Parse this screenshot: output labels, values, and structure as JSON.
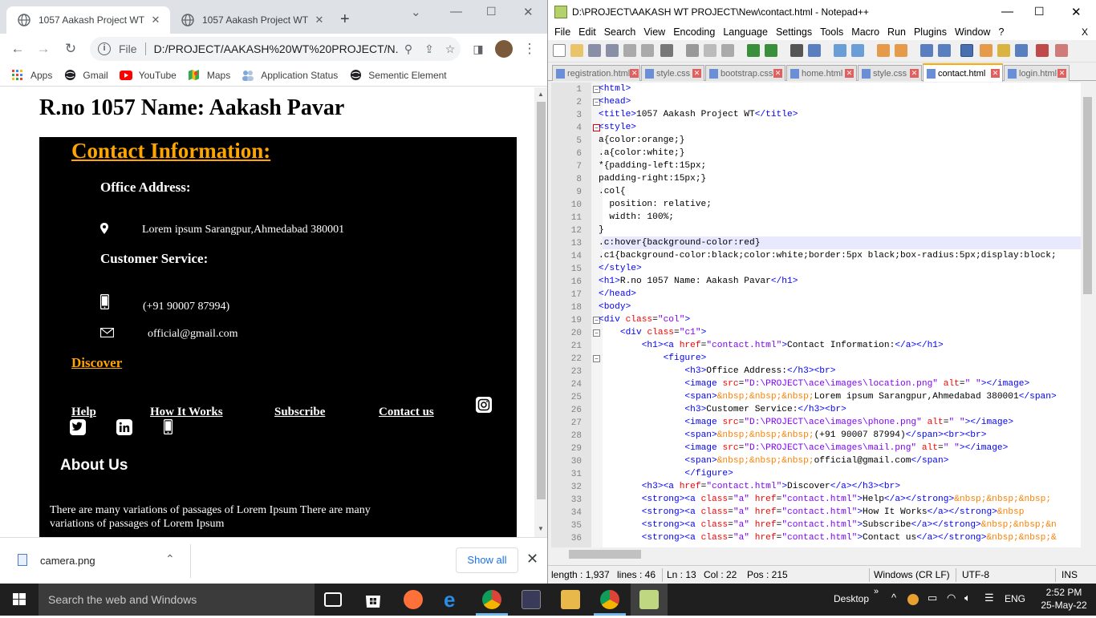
{
  "chrome": {
    "tabs": [
      {
        "title": "1057 Aakash Project WT",
        "active": true
      },
      {
        "title": "1057 Aakash Project WT",
        "active": false
      }
    ],
    "address": {
      "scheme_label": "File",
      "url": "D:/PROJECT/AAKASH%20WT%20PROJECT/N..."
    },
    "bookmarks": [
      "Apps",
      "Gmail",
      "YouTube",
      "Maps",
      "Application Status",
      "Sementic Element"
    ],
    "page": {
      "heading": "R.no 1057 Name: Aakash Pavar",
      "contact_title": "Contact Information:",
      "office_heading": "Office Address:",
      "office_text": "Lorem ipsum Sarangpur,Ahmedabad 380001",
      "customer_heading": "Customer Service:",
      "phone_text": "(+91 90007 87994)",
      "email_text": "official@gmail.com",
      "discover": "Discover",
      "links": [
        "Help",
        "How It Works",
        "Subscribe",
        "Contact us"
      ],
      "about_heading": "About Us",
      "about_text": "There are many variations of passages of Lorem Ipsum There are many variations of passages of Lorem Ipsum"
    },
    "download": {
      "filename": "camera.png",
      "show_all": "Show all"
    }
  },
  "notepad": {
    "title": "D:\\PROJECT\\AAKASH WT PROJECT\\New\\contact.html - Notepad++",
    "menu": [
      "File",
      "Edit",
      "Search",
      "View",
      "Encoding",
      "Language",
      "Settings",
      "Tools",
      "Macro",
      "Run",
      "Plugins",
      "Window",
      "?"
    ],
    "menu_close": "X",
    "tabs": [
      "registration.html",
      "style.css",
      "bootstrap.css",
      "home.html",
      "style.css",
      "contact.html",
      "login.html"
    ],
    "active_tab": "contact.html",
    "line_numbers": [
      "1",
      "2",
      "3",
      "4",
      "5",
      "6",
      "7",
      "8",
      "9",
      "10",
      "11",
      "12",
      "13",
      "14",
      "15",
      "16",
      "17",
      "18",
      "19",
      "20",
      "21",
      "22",
      "23",
      "24",
      "25",
      "26",
      "27",
      "28",
      "29",
      "30",
      "31",
      "32",
      "33",
      "34",
      "35",
      "36"
    ],
    "status": {
      "length": "length : 1,937",
      "lines": "lines : 46",
      "ln": "Ln : 13",
      "col": "Col : 22",
      "pos": "Pos : 215",
      "eol": "Windows (CR LF)",
      "encoding": "UTF-8",
      "mode": "INS"
    }
  },
  "taskbar": {
    "search_placeholder": "Search the web and Windows",
    "desktop_label": "Desktop",
    "language": "ENG",
    "time": "2:52 PM",
    "date": "25-May-22"
  },
  "colors": {
    "accent_orange": "#ffa500",
    "chrome_tabstrip": "#dee1e6",
    "npp_tab_active": "#ffaa00"
  }
}
